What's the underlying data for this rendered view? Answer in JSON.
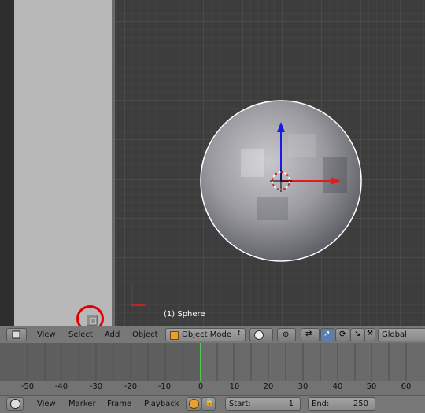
{
  "viewport": {
    "object_label": "(1) Sphere"
  },
  "header_3d": {
    "menus": [
      "View",
      "Select",
      "Add",
      "Object"
    ],
    "mode": "Object Mode",
    "orientation": "Global"
  },
  "timeline": {
    "ruler_ticks": [
      "-50",
      "-40",
      "-30",
      "-20",
      "-10",
      "0",
      "10",
      "20",
      "30",
      "40",
      "50",
      "60"
    ],
    "current_frame": 0
  },
  "header_timeline": {
    "menus": [
      "View",
      "Marker",
      "Frame",
      "Playback"
    ],
    "start_label": "Start:",
    "start_value": "1",
    "end_label": "End:",
    "end_value": "250"
  },
  "colors": {
    "accent_red": "#e10000",
    "axis_blue": "#1a1ae6",
    "axis_red": "#e61a1a",
    "frame_green": "#4ec94e"
  }
}
